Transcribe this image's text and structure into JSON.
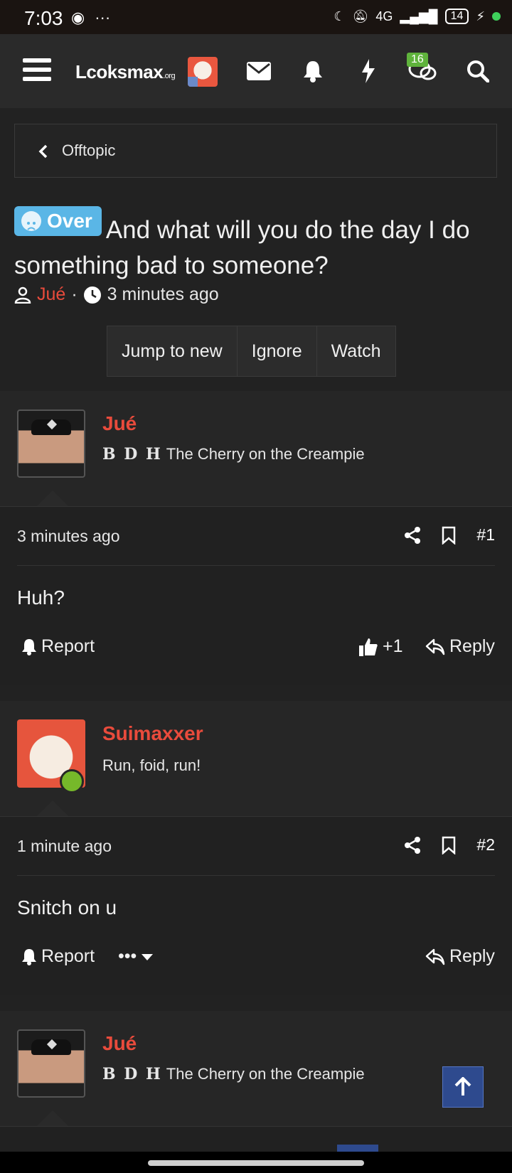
{
  "status_bar": {
    "time": "7:03",
    "network": "4G",
    "battery": "14"
  },
  "header": {
    "logo": "Lcoksmax",
    "logo_suffix": ".org",
    "conversations_badge": "16"
  },
  "breadcrumb": {
    "label": "Offtopic"
  },
  "thread": {
    "prefix": "Over",
    "title": "And what will you do the day I do something bad to someone?",
    "author": "Jué",
    "time": "3 minutes ago"
  },
  "thread_buttons": [
    "Jump to new",
    "Ignore",
    "Watch"
  ],
  "posts": [
    {
      "username": "Jué",
      "badge_letters": "B D H",
      "user_title": "The Cherry on the Creampie",
      "time": "3 minutes ago",
      "number": "#1",
      "text": "Huh?",
      "report_label": "Report",
      "reaction_count": "+1",
      "reply_label": "Reply"
    },
    {
      "username": "Suimaxxer",
      "user_title": "Run, foid, run!",
      "time": "1 minute ago",
      "number": "#2",
      "text": "Snitch on u",
      "report_label": "Report",
      "more_label": "•••",
      "reply_label": "Reply"
    },
    {
      "username": "Jué",
      "badge_letters": "B D H",
      "user_title": "The Cherry on the Creampie"
    }
  ],
  "colors": {
    "accent": "#e94b3c",
    "prefix_bg": "#5ab6e6",
    "badge_green": "#5fb33c",
    "scroll_top_bg": "#2e4a8e"
  }
}
